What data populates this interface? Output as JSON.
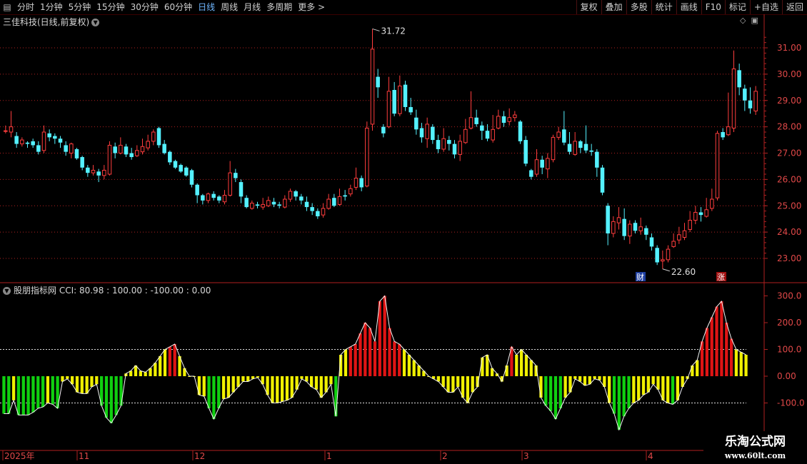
{
  "toolbar": {
    "periods": [
      "分时",
      "1分钟",
      "5分钟",
      "15分钟",
      "30分钟",
      "60分钟",
      "日线",
      "周线",
      "月线",
      "多周期",
      "更多 >"
    ],
    "active_period": "日线",
    "buttons": [
      "复权",
      "叠加",
      "多股",
      "统计",
      "画线",
      "F10",
      "标记",
      "+自选",
      "返回"
    ]
  },
  "stock_title": "三佳科技(日线,前复权)",
  "indicator_title": "股朋指标网 CCI: 80.98 : 100.00 : -100.00 : 0.00",
  "price_axis": [
    "31.00",
    "30.00",
    "29.00",
    "28.00",
    "27.00",
    "26.00",
    "25.00",
    "24.00",
    "23.00"
  ],
  "cci_axis": [
    "300.0",
    "200.0",
    "100.0",
    "0.00",
    "-100.0"
  ],
  "annotations": {
    "high": "31.72",
    "low": "22.60",
    "marker_cai": "财",
    "marker_zhang": "涨"
  },
  "date_axis": [
    "2025年",
    "11",
    "12",
    "1",
    "2",
    "3",
    "4"
  ],
  "watermark": {
    "line1": "乐淘公式网",
    "line2": "www.60lt.com"
  },
  "colors": {
    "up": "#ff3d3d",
    "down": "#54f1ff",
    "cci_high": "#e01414",
    "cci_mid": "#f0f000",
    "cci_low": "#10d010",
    "grid": "#b02020"
  },
  "chart_data": [
    {
      "type": "candlestick",
      "ylim": [
        22.3,
        32.0
      ],
      "candles": [
        [
          27.85,
          27.85,
          28.05,
          27.75
        ],
        [
          27.8,
          28.0,
          28.6,
          27.6
        ],
        [
          27.65,
          27.35,
          27.8,
          27.2
        ],
        [
          27.35,
          27.5,
          27.6,
          27.25
        ],
        [
          27.4,
          27.35,
          27.45,
          27.2
        ],
        [
          27.45,
          27.3,
          27.55,
          27.2
        ],
        [
          27.3,
          27.05,
          27.45,
          26.95
        ],
        [
          27.1,
          27.8,
          28.05,
          27.0
        ],
        [
          27.75,
          27.6,
          27.9,
          27.45
        ],
        [
          27.65,
          27.55,
          27.75,
          27.35
        ],
        [
          27.55,
          27.4,
          27.65,
          27.2
        ],
        [
          27.3,
          27.05,
          27.45,
          26.9
        ],
        [
          27.0,
          27.35,
          27.4,
          26.8
        ],
        [
          27.15,
          26.8,
          27.2,
          26.75
        ],
        [
          26.85,
          26.45,
          26.9,
          26.35
        ],
        [
          26.45,
          26.25,
          26.55,
          26.1
        ],
        [
          26.25,
          26.35,
          26.55,
          26.15
        ],
        [
          26.3,
          26.15,
          26.4,
          25.9
        ],
        [
          26.15,
          26.35,
          26.55,
          26.0
        ],
        [
          26.2,
          27.3,
          27.45,
          26.15
        ],
        [
          27.25,
          27.0,
          27.4,
          26.8
        ],
        [
          27.0,
          27.3,
          27.6,
          26.95
        ],
        [
          27.25,
          26.95,
          27.35,
          26.85
        ],
        [
          27.0,
          26.85,
          27.2,
          26.75
        ],
        [
          26.9,
          27.1,
          27.3,
          26.85
        ],
        [
          27.05,
          27.25,
          27.55,
          26.95
        ],
        [
          27.2,
          27.45,
          27.7,
          27.1
        ],
        [
          27.45,
          27.8,
          27.9,
          27.3
        ],
        [
          27.95,
          27.3,
          28.0,
          27.2
        ],
        [
          27.35,
          27.0,
          27.5,
          26.95
        ],
        [
          27.05,
          26.65,
          27.1,
          26.55
        ],
        [
          26.7,
          26.45,
          26.75,
          26.4
        ],
        [
          26.55,
          26.3,
          26.6,
          26.25
        ],
        [
          26.45,
          26.15,
          26.5,
          26.1
        ],
        [
          26.35,
          25.8,
          26.4,
          25.7
        ],
        [
          25.8,
          25.4,
          25.85,
          25.1
        ],
        [
          25.4,
          25.2,
          25.45,
          25.05
        ],
        [
          25.2,
          25.45,
          25.5,
          25.1
        ],
        [
          25.45,
          25.3,
          25.55,
          25.2
        ],
        [
          25.35,
          25.2,
          25.4,
          25.1
        ],
        [
          25.15,
          25.4,
          25.6,
          25.05
        ],
        [
          25.4,
          26.25,
          26.7,
          25.35
        ],
        [
          26.25,
          26.05,
          26.4,
          25.9
        ],
        [
          25.9,
          25.35,
          26.0,
          25.1
        ],
        [
          25.3,
          24.95,
          25.4,
          24.9
        ],
        [
          24.9,
          25.1,
          25.2,
          24.85
        ],
        [
          25.05,
          25.0,
          25.15,
          24.9
        ],
        [
          24.95,
          25.05,
          25.3,
          24.85
        ],
        [
          25.0,
          25.2,
          25.35,
          24.95
        ],
        [
          25.15,
          25.05,
          25.3,
          24.95
        ],
        [
          25.05,
          25.0,
          25.15,
          24.9
        ],
        [
          24.95,
          25.25,
          25.4,
          24.9
        ],
        [
          25.25,
          25.55,
          25.65,
          25.15
        ],
        [
          25.55,
          25.35,
          25.6,
          25.2
        ],
        [
          25.35,
          25.2,
          25.45,
          25.05
        ],
        [
          25.15,
          24.95,
          25.35,
          24.8
        ],
        [
          24.95,
          24.8,
          25.1,
          24.65
        ],
        [
          24.8,
          24.6,
          24.9,
          24.5
        ],
        [
          24.65,
          24.9,
          25.1,
          24.55
        ],
        [
          24.9,
          25.25,
          25.45,
          24.85
        ],
        [
          25.3,
          25.0,
          25.45,
          24.95
        ],
        [
          25.05,
          25.35,
          25.65,
          25.0
        ],
        [
          25.4,
          25.35,
          25.6,
          25.2
        ],
        [
          25.45,
          25.65,
          25.8,
          25.35
        ],
        [
          25.7,
          26.05,
          26.45,
          25.6
        ],
        [
          26.05,
          25.7,
          26.15,
          25.55
        ],
        [
          25.75,
          27.95,
          28.2,
          25.7
        ],
        [
          28.1,
          30.95,
          31.72,
          27.85
        ],
        [
          29.9,
          29.5,
          30.2,
          29.1
        ],
        [
          28.0,
          27.75,
          28.1,
          27.6
        ],
        [
          28.0,
          29.35,
          29.9,
          27.95
        ],
        [
          29.4,
          28.5,
          29.7,
          28.4
        ],
        [
          28.5,
          29.55,
          29.95,
          28.4
        ],
        [
          29.6,
          28.75,
          29.75,
          28.6
        ],
        [
          28.75,
          28.55,
          29.1,
          28.45
        ],
        [
          28.35,
          27.9,
          28.65,
          27.7
        ],
        [
          27.95,
          27.6,
          28.15,
          27.4
        ],
        [
          27.55,
          28.1,
          28.35,
          27.2
        ],
        [
          28.0,
          27.5,
          28.1,
          27.35
        ],
        [
          27.5,
          27.15,
          27.7,
          27.0
        ],
        [
          27.15,
          27.55,
          27.95,
          27.05
        ],
        [
          27.5,
          27.35,
          27.65,
          27.1
        ],
        [
          27.35,
          26.95,
          27.5,
          26.8
        ],
        [
          26.95,
          27.45,
          27.7,
          26.7
        ],
        [
          27.4,
          27.9,
          28.3,
          27.35
        ],
        [
          27.95,
          28.35,
          29.35,
          27.9
        ],
        [
          28.35,
          28.1,
          28.65,
          28.0
        ],
        [
          28.05,
          27.85,
          28.2,
          27.5
        ],
        [
          27.85,
          27.55,
          28.1,
          27.45
        ],
        [
          27.5,
          27.9,
          28.45,
          27.4
        ],
        [
          27.95,
          28.4,
          28.65,
          27.9
        ],
        [
          28.4,
          28.15,
          28.6,
          28.0
        ],
        [
          28.2,
          28.35,
          28.7,
          28.05
        ],
        [
          28.35,
          28.45,
          28.6,
          28.2
        ],
        [
          28.2,
          27.45,
          28.25,
          27.35
        ],
        [
          27.5,
          26.6,
          27.65,
          26.5
        ],
        [
          26.35,
          26.1,
          26.4,
          26.0
        ],
        [
          26.2,
          26.75,
          27.15,
          26.1
        ],
        [
          26.75,
          26.45,
          26.9,
          26.2
        ],
        [
          26.4,
          26.8,
          27.0,
          26.05
        ],
        [
          26.75,
          27.6,
          27.7,
          26.65
        ],
        [
          27.6,
          27.8,
          28.0,
          27.5
        ],
        [
          27.9,
          27.4,
          28.6,
          27.3
        ],
        [
          27.35,
          27.05,
          27.8,
          26.95
        ],
        [
          26.95,
          27.45,
          27.8,
          26.9
        ],
        [
          27.45,
          27.2,
          27.5,
          27.0
        ],
        [
          27.35,
          27.1,
          28.05,
          27.0
        ],
        [
          27.1,
          27.05,
          27.35,
          26.9
        ],
        [
          27.05,
          26.45,
          27.15,
          26.1
        ],
        [
          26.45,
          25.5,
          26.55,
          25.4
        ],
        [
          25.0,
          23.95,
          25.1,
          23.5
        ],
        [
          23.95,
          24.4,
          24.6,
          23.8
        ],
        [
          24.35,
          24.55,
          24.95,
          24.1
        ],
        [
          24.5,
          23.85,
          24.9,
          23.7
        ],
        [
          23.85,
          24.3,
          24.45,
          23.55
        ],
        [
          24.35,
          24.05,
          24.45,
          23.95
        ],
        [
          24.05,
          24.2,
          24.55,
          23.9
        ],
        [
          24.15,
          23.9,
          24.25,
          23.7
        ],
        [
          23.8,
          23.45,
          23.95,
          23.3
        ],
        [
          23.4,
          22.85,
          23.5,
          22.75
        ],
        [
          22.9,
          22.95,
          23.3,
          22.6
        ],
        [
          22.95,
          23.35,
          23.5,
          22.85
        ],
        [
          23.45,
          23.65,
          23.95,
          23.4
        ],
        [
          23.7,
          23.9,
          24.2,
          23.55
        ],
        [
          23.8,
          24.05,
          24.35,
          23.7
        ],
        [
          24.1,
          24.45,
          24.8,
          24.0
        ],
        [
          24.45,
          24.75,
          25.0,
          24.3
        ],
        [
          24.75,
          24.65,
          24.95,
          24.4
        ],
        [
          24.6,
          24.85,
          25.3,
          24.55
        ],
        [
          24.9,
          25.25,
          25.65,
          24.8
        ],
        [
          25.3,
          27.75,
          27.85,
          25.2
        ],
        [
          27.8,
          27.6,
          27.95,
          27.5
        ],
        [
          27.7,
          28.0,
          29.3,
          27.65
        ],
        [
          27.95,
          30.2,
          30.9,
          27.8
        ],
        [
          30.15,
          29.5,
          30.4,
          29.2
        ],
        [
          29.45,
          29.0,
          29.6,
          28.6
        ],
        [
          29.0,
          28.7,
          29.5,
          28.5
        ],
        [
          28.6,
          29.35,
          29.55,
          28.45
        ]
      ]
    },
    {
      "type": "bar",
      "name": "CCI",
      "ylim": [
        -160,
        320
      ],
      "levels": [
        100,
        0,
        -100
      ],
      "values": [
        -140,
        -140,
        -90,
        -145,
        -145,
        -145,
        -135,
        -120,
        -115,
        -100,
        -105,
        -120,
        -20,
        -10,
        -30,
        -60,
        -65,
        -65,
        -40,
        -30,
        -110,
        -155,
        -175,
        -145,
        -110,
        10,
        20,
        40,
        20,
        15,
        30,
        50,
        75,
        100,
        110,
        120,
        75,
        30,
        0,
        0,
        -70,
        -75,
        -120,
        -160,
        -120,
        -85,
        -80,
        -60,
        -40,
        -20,
        -20,
        -10,
        -5,
        -30,
        -70,
        -100,
        -100,
        -95,
        -90,
        -80,
        -50,
        -10,
        -20,
        -40,
        -50,
        -80,
        -60,
        -30,
        -150,
        80,
        100,
        110,
        120,
        160,
        200,
        180,
        130,
        280,
        300,
        180,
        130,
        120,
        100,
        80,
        60,
        40,
        20,
        0,
        -10,
        -20,
        -40,
        -60,
        -60,
        -40,
        -80,
        -100,
        -60,
        -40,
        70,
        80,
        30,
        10,
        -20,
        40,
        110,
        80,
        100,
        80,
        60,
        40,
        -80,
        -110,
        -130,
        -160,
        -120,
        -80,
        -60,
        -10,
        -20,
        -35,
        -30,
        -10,
        -15,
        -40,
        -100,
        -140,
        -200,
        -150,
        -120,
        -100,
        -90,
        -70,
        -60,
        -30,
        -50,
        -90,
        -100,
        -105,
        -90,
        -40,
        -10,
        40,
        60,
        130,
        180,
        220,
        260,
        280,
        200,
        140,
        100,
        90,
        80
      ]
    }
  ]
}
